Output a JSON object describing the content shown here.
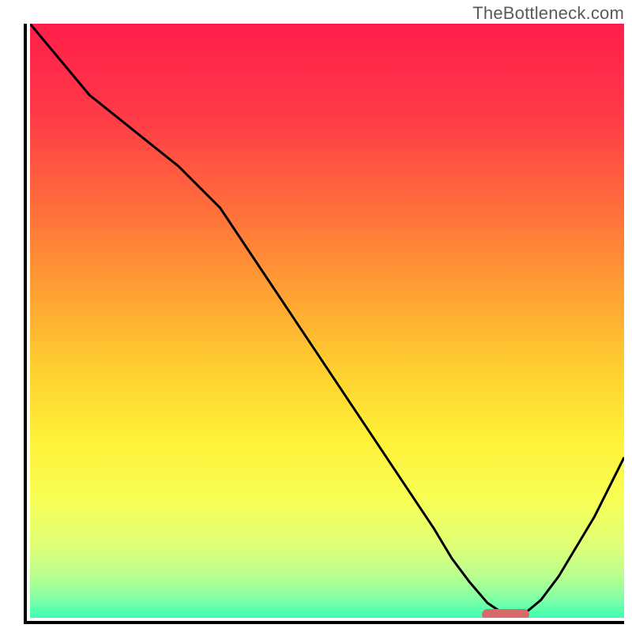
{
  "watermark": "TheBottleneck.com",
  "chart_data": {
    "type": "line",
    "title": "",
    "xlabel": "",
    "ylabel": "",
    "xlim": [
      0,
      100
    ],
    "ylim": [
      0,
      100
    ],
    "grid": false,
    "legend": false,
    "series": [
      {
        "name": "curve",
        "x": [
          0,
          5,
          10,
          15,
          20,
          25,
          28,
          32,
          36,
          40,
          44,
          48,
          52,
          56,
          60,
          64,
          68,
          71,
          74,
          77,
          80,
          83,
          86,
          89,
          92,
          95,
          98,
          100
        ],
        "y": [
          100,
          94,
          88,
          84,
          80,
          76,
          73,
          69,
          63,
          57,
          51,
          45,
          39,
          33,
          27,
          21,
          15,
          10,
          6,
          2.5,
          0.5,
          0.5,
          3,
          7,
          12,
          17,
          23,
          27
        ]
      }
    ],
    "gradient_stops": [
      {
        "offset": 0,
        "color": "#ff1e4a"
      },
      {
        "offset": 15,
        "color": "#ff3948"
      },
      {
        "offset": 30,
        "color": "#ff6a3c"
      },
      {
        "offset": 45,
        "color": "#ffa033"
      },
      {
        "offset": 58,
        "color": "#ffcf30"
      },
      {
        "offset": 70,
        "color": "#fff138"
      },
      {
        "offset": 80,
        "color": "#f8ff55"
      },
      {
        "offset": 88,
        "color": "#dfff77"
      },
      {
        "offset": 93,
        "color": "#b8ff8f"
      },
      {
        "offset": 97,
        "color": "#7fffa6"
      },
      {
        "offset": 100,
        "color": "#3cffb1"
      }
    ],
    "marker": {
      "x_start": 76,
      "x_end": 84,
      "y": 0.5,
      "color": "#d86a6a"
    }
  }
}
